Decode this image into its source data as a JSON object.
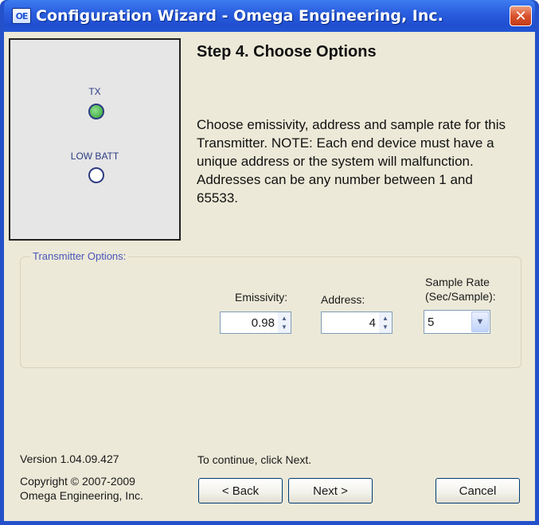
{
  "window": {
    "title": "Configuration Wizard - Omega Engineering, Inc.",
    "icon_text": "OE",
    "close_symbol": "✕"
  },
  "indicators": {
    "tx_label": "TX",
    "low_batt_label": "LOW BATT",
    "tx_state": "on",
    "low_batt_state": "off"
  },
  "step": {
    "title": "Step 4.  Choose Options",
    "description": "Choose emissivity, address and sample rate for this Transmitter.  NOTE: Each end device must have a unique address or the system will malfunction.  Addresses can be any number between 1 and 65533."
  },
  "options": {
    "group_label": "Transmitter Options:",
    "emissivity_label": "Emissivity:",
    "emissivity_value": "0.98",
    "address_label": "Address:",
    "address_value": "4",
    "sample_rate_label_line1": "Sample Rate",
    "sample_rate_label_line2": "(Sec/Sample):",
    "sample_rate_value": "5"
  },
  "footer": {
    "version": "Version 1.04.09.427",
    "copyright_line1": "Copyright © 2007-2009",
    "copyright_line2": "Omega Engineering, Inc.",
    "hint": "To continue, click Next."
  },
  "buttons": {
    "back": "< Back",
    "next": "Next >",
    "cancel": "Cancel"
  },
  "icons": {
    "spin_up": "▲",
    "spin_down": "▼",
    "dropdown": "▼"
  },
  "colors": {
    "title_bar": "#2a5fe0",
    "dialog_bg": "#ece9d8",
    "tx_led": "#2fa02f",
    "close_button": "#d8512c"
  }
}
